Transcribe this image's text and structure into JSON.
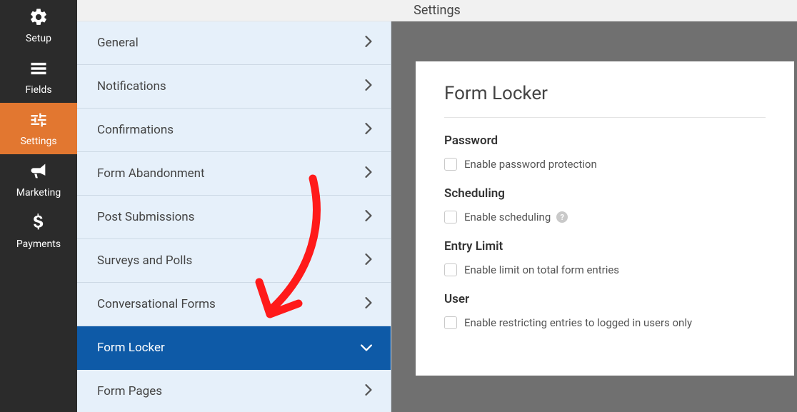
{
  "page_title": "Settings",
  "sidebar": {
    "items": [
      {
        "label": "Setup",
        "icon": "gear-icon"
      },
      {
        "label": "Fields",
        "icon": "list-form-icon"
      },
      {
        "label": "Settings",
        "icon": "sliders-icon",
        "active": true
      },
      {
        "label": "Marketing",
        "icon": "bullhorn-icon"
      },
      {
        "label": "Payments",
        "icon": "dollar-icon"
      }
    ]
  },
  "settings_menu": {
    "items": [
      {
        "label": "General"
      },
      {
        "label": "Notifications"
      },
      {
        "label": "Confirmations"
      },
      {
        "label": "Form Abandonment"
      },
      {
        "label": "Post Submissions"
      },
      {
        "label": "Surveys and Polls"
      },
      {
        "label": "Conversational Forms"
      },
      {
        "label": "Form Locker",
        "active": true
      },
      {
        "label": "Form Pages"
      }
    ]
  },
  "form_locker": {
    "title": "Form Locker",
    "sections": {
      "password": {
        "heading": "Password",
        "check_label": "Enable password protection"
      },
      "scheduling": {
        "heading": "Scheduling",
        "check_label": "Enable scheduling"
      },
      "entry_limit": {
        "heading": "Entry Limit",
        "check_label": "Enable limit on total form entries"
      },
      "user": {
        "heading": "User",
        "check_label": "Enable restricting entries to logged in users only"
      }
    }
  },
  "colors": {
    "accent_orange": "#e27730",
    "accent_blue": "#0e5aa7",
    "panel_blue": "#e6f0fa",
    "annotation_red": "#ff1a1a"
  }
}
